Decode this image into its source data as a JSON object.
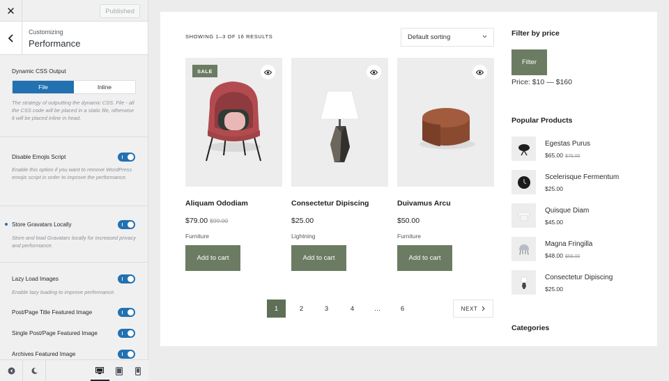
{
  "customizer": {
    "published_label": "Published",
    "section_sub": "Customizing",
    "section_title": "Performance",
    "dynamic_css": {
      "label": "Dynamic CSS Output",
      "options": [
        "File",
        "Inline"
      ],
      "selected": "File",
      "description": "The strategy of outputting the dynamic CSS. File - all the CSS code will be placed in a static file, otherwise it will be placed inline in head."
    },
    "disable_emojis": {
      "label": "Disable Emojis Script",
      "enabled": true,
      "description": "Enable this option if you want to remove WordPress emojis script in order to improve the performance."
    },
    "store_gravatars": {
      "label": "Store Gravatars Locally",
      "enabled": true,
      "description": "Store and load Gravatars locally for increased privacy and performance."
    },
    "lazy_load": {
      "label": "Lazy Load Images",
      "enabled": true,
      "description": "Enable lazy loading to improve performance."
    },
    "post_page_featured": {
      "label": "Post/Page Title Featured Image",
      "enabled": true
    },
    "single_featured": {
      "label": "Single Post/Page Featured Image",
      "enabled": true
    },
    "archives_featured": {
      "label": "Archives Featured Image",
      "enabled": true
    },
    "active_device": "desktop"
  },
  "shop": {
    "results_text": "SHOWING 1–3 OF 16 RESULTS",
    "sort_value": "Default sorting",
    "sale_badge": "SALE",
    "add_to_cart": "Add to cart",
    "products": [
      {
        "name": "Aliquam Ododiam",
        "price": "$79.00",
        "old_price": "$99.00",
        "category": "Furniture",
        "on_sale": true,
        "image": "armchair"
      },
      {
        "name": "Consectetur Dipiscing",
        "price": "$25.00",
        "old_price": "",
        "category": "Lightning",
        "on_sale": false,
        "image": "lamp"
      },
      {
        "name": "Duivamus Arcu",
        "price": "$50.00",
        "old_price": "",
        "category": "Furniture",
        "on_sale": false,
        "image": "pouf"
      }
    ],
    "pagination": {
      "pages": [
        "1",
        "2",
        "3",
        "4",
        "…",
        "6"
      ],
      "current": "1",
      "next_label": "NEXT"
    }
  },
  "widgets": {
    "filter_title": "Filter by price",
    "filter_button": "Filter",
    "price_range": "Price: $10 — $160",
    "popular_title": "Popular Products",
    "popular": [
      {
        "name": "Egestas Purus",
        "price": "$65.00",
        "old_price": "$75.00",
        "image": "black-chair"
      },
      {
        "name": "Scelerisque Fermentum",
        "price": "$25.00",
        "old_price": "",
        "image": "clock"
      },
      {
        "name": "Quisque Diam",
        "price": "$45.00",
        "old_price": "",
        "image": "white-table"
      },
      {
        "name": "Magna Fringilla",
        "price": "$48.00",
        "old_price": "$58.00",
        "image": "grey-chair"
      },
      {
        "name": "Consectetur Dipiscing",
        "price": "$25.00",
        "old_price": "",
        "image": "lamp"
      }
    ],
    "categories_title": "Categories"
  },
  "colors": {
    "accent_blue": "#2271b1",
    "shop_green": "#6b7c62"
  }
}
